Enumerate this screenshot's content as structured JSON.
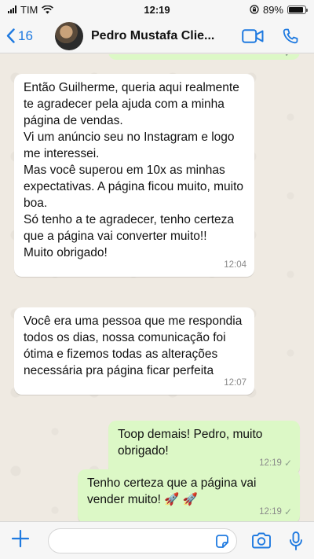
{
  "status_bar": {
    "carrier": "TIM",
    "time": "12:19",
    "battery": "89%",
    "battery_level": 0.89
  },
  "header": {
    "back_count": "16",
    "contact_name": "Pedro Mustafa Clie..."
  },
  "messages": [
    {
      "direction": "in",
      "text": "Então Guilherme, queria aqui realmente te agradecer pela ajuda com a minha página de vendas.\nVi um anúncio seu no Instagram e logo me interessei.\nMas você superou em 10x as minhas expectativas. A página ficou muito, muito boa.\nSó tenho a te agradecer, tenho certeza que a página vai converter muito!!\nMuito obrigado!",
      "time": "12:04"
    },
    {
      "direction": "in",
      "text": "Você era uma pessoa que me respondia todos os dias, nossa comunicação foi ótima e fizemos todas as alterações necessária pra página ficar perfeita",
      "time": "12:07"
    },
    {
      "direction": "out",
      "text": "Toop demais! Pedro, muito obrigado!",
      "time": "12:19",
      "status": "sent"
    },
    {
      "direction": "out",
      "text": "Tenho certeza que a página vai vender muito! 🚀 🚀",
      "time": "12:19",
      "status": "sent"
    }
  ],
  "icons": {
    "back": "chevron-left-icon",
    "video": "video-camera-icon",
    "call": "phone-icon",
    "attach": "plus-icon",
    "sticker": "sticker-icon",
    "camera": "camera-icon",
    "mic": "microphone-icon"
  },
  "colors": {
    "accent": "#1f7ae0",
    "outgoing_bubble": "#dcf8c6",
    "incoming_bubble": "#ffffff",
    "chat_background": "#efeae2"
  }
}
